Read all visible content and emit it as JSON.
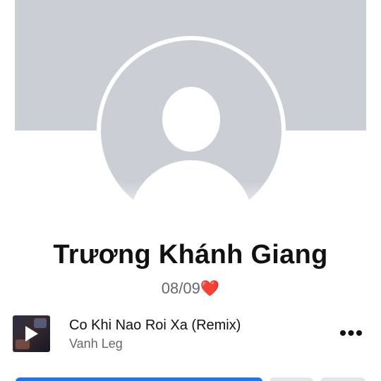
{
  "profile": {
    "name": "Trương Khánh Giang",
    "bio_text": "08/09",
    "bio_emoji": "❤️"
  },
  "music": {
    "title": "Co Khi Nao Roi Xa (Remix)",
    "artist": "Vanh Leg"
  },
  "icons": {
    "more": "more-options-icon",
    "play": "play-icon",
    "heart": "heart-emoji"
  },
  "colors": {
    "cover": "#ccced6",
    "primary_button": "#1877f2",
    "secondary_button": "#e4e6eb",
    "heart": "#e0245e"
  }
}
